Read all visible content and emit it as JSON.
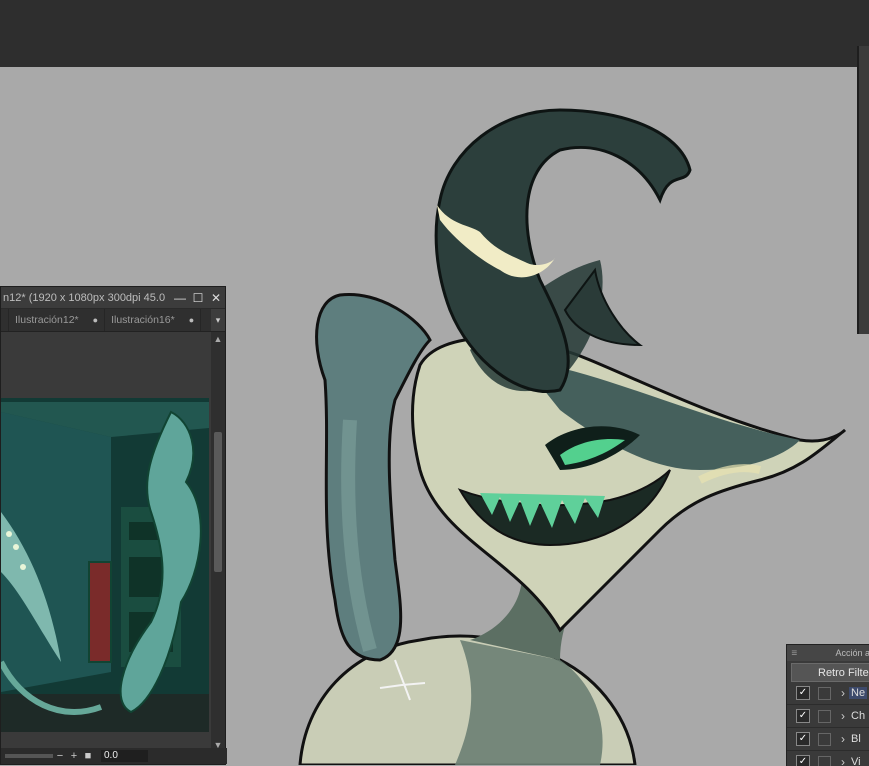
{
  "app": {
    "sub_window": {
      "title": "n12* (1920 x 1080px 300dpi 45.0",
      "tabs": [
        {
          "label": "Ilustración12*",
          "modified_dot": "●"
        },
        {
          "label": "Ilustración16*",
          "modified_dot": "●"
        }
      ],
      "tab_menu_icon": "chevron-down-icon",
      "rotation_value": "0.0",
      "footer_buttons": [
        "−",
        "+",
        "■"
      ]
    },
    "auto_action_panel": {
      "title": "Acción a",
      "set_name": "Retro Filters",
      "actions": [
        {
          "label": "Ne",
          "checked": true,
          "selected": true
        },
        {
          "label": "Ch",
          "checked": true,
          "selected": false
        },
        {
          "label": "Bl",
          "checked": true,
          "selected": false
        },
        {
          "label": "Vi",
          "checked": true,
          "selected": false
        }
      ]
    }
  },
  "colors": {
    "canvas_bg": "#a9a9a9",
    "toolbar_bg": "#2e2e2e",
    "panel_bg": "#3a3a3a",
    "selection": "#3d4a6b"
  }
}
